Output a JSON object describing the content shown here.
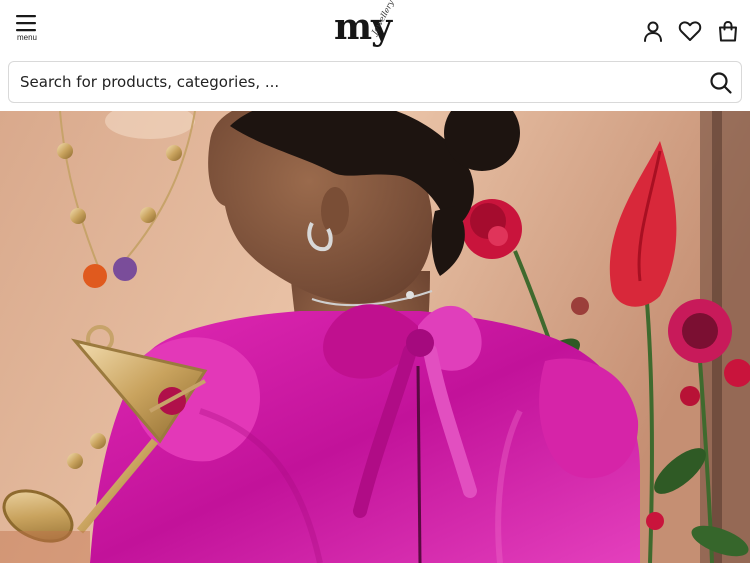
{
  "header": {
    "menu_label": "menu",
    "logo_text": "my",
    "logo_subtext": "Jewellery",
    "icons": {
      "menu": "hamburger-menu-icon",
      "account": "user-icon",
      "wishlist": "heart-icon",
      "cart": "shopping-bag-icon"
    }
  },
  "search": {
    "placeholder": "Search for products, categories, ...",
    "icon": "search-icon"
  },
  "hero": {
    "image_alt": "Model in pink satin blouse with bow, cocktail-glass pendant necklace and roses"
  },
  "colors": {
    "brand_text": "#161616",
    "blouse_pink": "#d61aa8",
    "background_peach": "#e2b396",
    "rose_red": "#c9143c"
  }
}
